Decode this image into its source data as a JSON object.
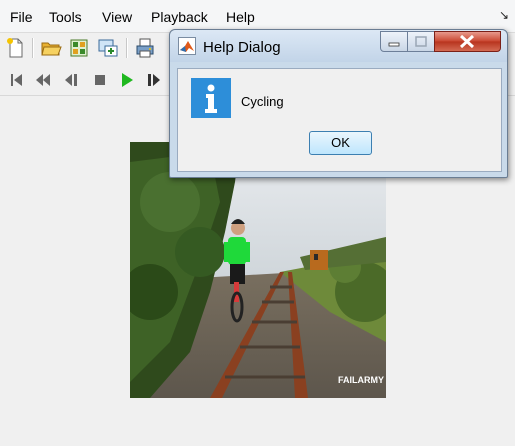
{
  "menubar": {
    "items": [
      "File",
      "Tools",
      "View",
      "Playback",
      "Help"
    ]
  },
  "toolbar": {
    "buttons": [
      "new-icon",
      "open-icon",
      "import-icon",
      "export-icon",
      "print-icon"
    ]
  },
  "playback": {
    "buttons": [
      "go-to-first-icon",
      "rewind-icon",
      "step-back-icon",
      "stop-icon",
      "play-icon",
      "step-forward-icon"
    ],
    "play_color": "#1fb81f"
  },
  "video": {
    "watermark": "FAILARMY"
  },
  "help_dialog": {
    "title": "Help Dialog",
    "message": "Cycling",
    "ok_label": "OK",
    "info_icon_color": "#2d8ed9"
  }
}
